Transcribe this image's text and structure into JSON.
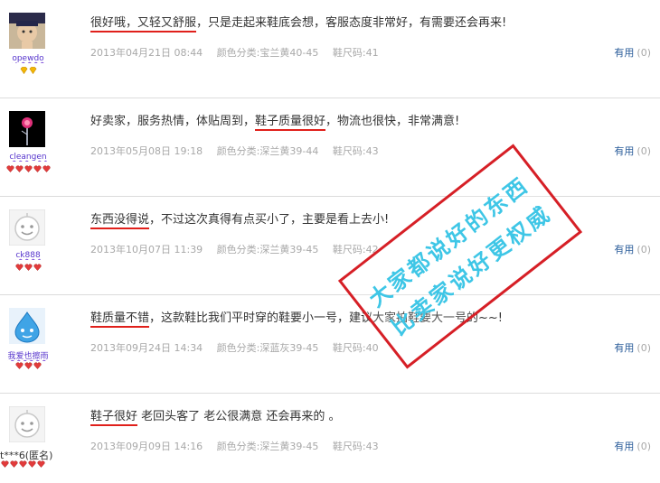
{
  "reviews": [
    {
      "nickname": "opewdo",
      "text_parts": [
        "很好哦，又轻又舒服",
        "，只是走起来鞋底会想，客服态度非常好，有需要还会再来!"
      ],
      "highlight_first": true,
      "date": "2013年04月21日 08:44",
      "color": "颜色分类:宝兰黄40-45",
      "size": "鞋尺码:41",
      "useful_label": "有用",
      "useful_count": "(0)",
      "rank_icon": "yellow-diamond-icon",
      "rank_count": 2
    },
    {
      "nickname": "cleangen",
      "text_parts": [
        "好卖家，服务热情，体贴周到，",
        "鞋子质量很好",
        "，物流也很快，非常满意!"
      ],
      "highlight_index": 1,
      "date": "2013年05月08日 19:18",
      "color": "颜色分类:深兰黄39-44",
      "size": "鞋尺码:43",
      "useful_label": "有用",
      "useful_count": "(0)",
      "rank_icon": "red-heart-icon",
      "rank_count": 5
    },
    {
      "nickname": "ck888",
      "text_parts": [
        "东西没得说",
        "，不过这次真得有点买小了，主要是看上去小!"
      ],
      "highlight_index": 0,
      "date": "2013年10月07日 11:39",
      "color": "颜色分类:深兰黄39-45",
      "size": "鞋尺码:42",
      "useful_label": "有用",
      "useful_count": "(0)",
      "rank_icon": "red-heart-icon",
      "rank_count": 3
    },
    {
      "nickname": "我爱也擦雨",
      "text_parts": [
        "鞋质量不错",
        "，这款鞋比我们平时穿的鞋要小一号，建议大家拍鞋要大一号的~~!"
      ],
      "highlight_index": 0,
      "date": "2013年09月24日 14:34",
      "color": "颜色分类:深蓝灰39-45",
      "size": "鞋尺码:40",
      "useful_label": "有用",
      "useful_count": "(0)",
      "rank_icon": "red-heart-icon",
      "rank_count": 3
    },
    {
      "nickname": "t***6(匿名)",
      "text_parts": [
        "鞋子很好",
        " 老回头客了 老公很满意 还会再来的 。"
      ],
      "highlight_index": 0,
      "date": "2013年09月09日 14:16",
      "color": "颜色分类:深兰黄39-45",
      "size": "鞋尺码:43",
      "useful_label": "有用",
      "useful_count": "(0)",
      "rank_icon": "red-heart-icon",
      "rank_count": 5
    }
  ],
  "stamp": {
    "line1": "大家都说好的东西",
    "line2": "比卖家说好更权威",
    "border_color": "#d61f26",
    "text_color": "#3ec6e6"
  },
  "colors": {
    "highlight_underline": "#e0201b",
    "meta_text": "#a8a8a8",
    "useful_link": "#2a5c9a"
  }
}
